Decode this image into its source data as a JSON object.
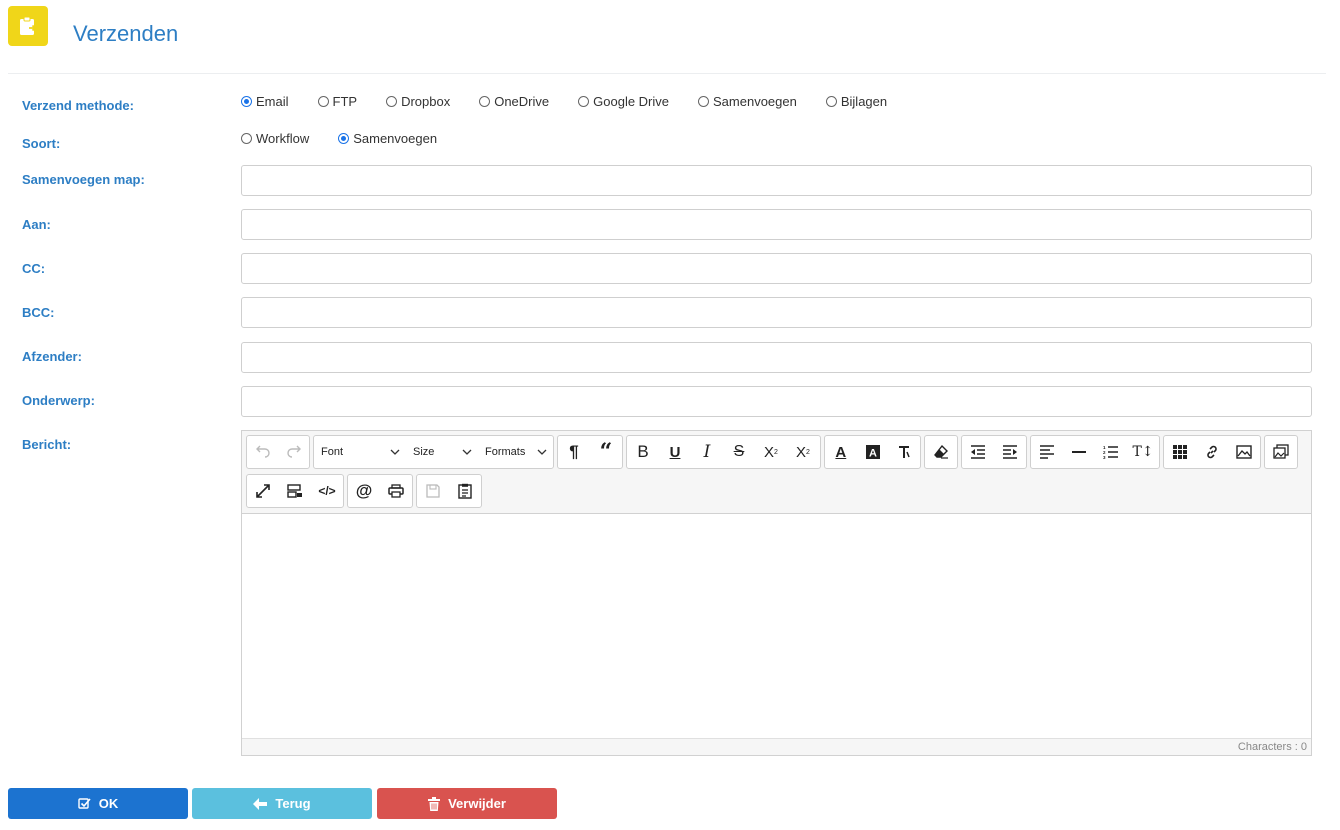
{
  "header": {
    "title": "Verzenden"
  },
  "form": {
    "method_label": "Verzend methode:",
    "methods": [
      {
        "label": "Email",
        "checked": true
      },
      {
        "label": "FTP",
        "checked": false
      },
      {
        "label": "Dropbox",
        "checked": false
      },
      {
        "label": "OneDrive",
        "checked": false
      },
      {
        "label": "Google Drive",
        "checked": false
      },
      {
        "label": "Samenvoegen",
        "checked": false
      },
      {
        "label": "Bijlagen",
        "checked": false
      }
    ],
    "type_label": "Soort:",
    "types": [
      {
        "label": "Workflow",
        "checked": false
      },
      {
        "label": "Samenvoegen",
        "checked": true
      }
    ],
    "merge_folder_label": "Samenvoegen map:",
    "to_label": "Aan:",
    "cc_label": "CC:",
    "bcc_label": "BCC:",
    "sender_label": "Afzender:",
    "subject_label": "Onderwerp:",
    "message_label": "Bericht:",
    "merge_folder_value": "",
    "to_value": "",
    "cc_value": "",
    "bcc_value": "",
    "sender_value": "",
    "subject_value": ""
  },
  "editor": {
    "font_select": "Font",
    "size_select": "Size",
    "formats_select": "Formats",
    "status": "Characters : 0"
  },
  "buttons": {
    "ok": "OK",
    "back": "Terug",
    "delete": "Verwijder"
  },
  "colors": {
    "accent": "#2d7ec4",
    "app_icon": "#f0d619",
    "ok": "#1c73d0",
    "back": "#5bc0de",
    "delete": "#d9534f"
  }
}
